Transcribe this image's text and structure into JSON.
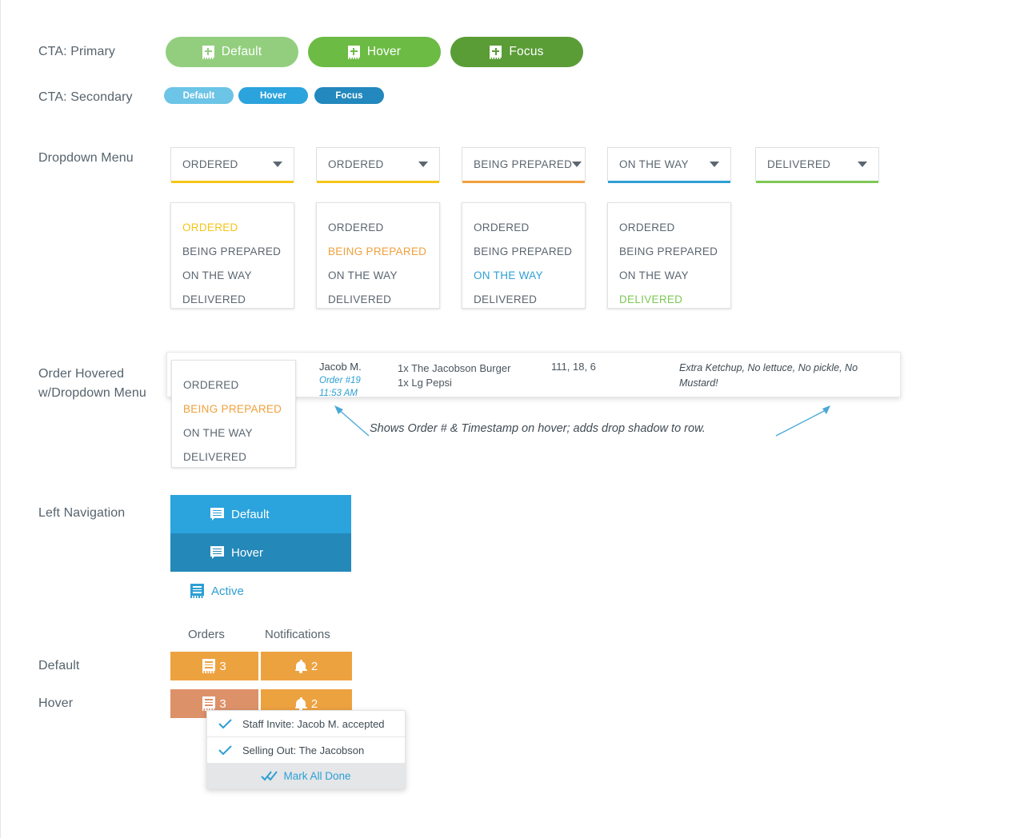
{
  "labels": {
    "cta_primary": "CTA: Primary",
    "cta_secondary": "CTA: Secondary",
    "dropdown_menu": "Dropdown Menu",
    "order_hovered": "Order Hovered w/Dropdown Menu",
    "left_navigation": "Left Navigation",
    "badge_default": "Default",
    "badge_hover": "Hover"
  },
  "cta_primary": {
    "buttons": [
      {
        "label": "Default",
        "color": "#92ce7e",
        "state": "default"
      },
      {
        "label": "Hover",
        "color": "#6cbb44",
        "state": "hover"
      },
      {
        "label": "Focus",
        "color": "#5a9c36",
        "state": "focus"
      }
    ],
    "icon": "receipt-plus-icon"
  },
  "cta_secondary": {
    "buttons": [
      {
        "label": "Default",
        "color": "#6cc4e6",
        "state": "default"
      },
      {
        "label": "Hover",
        "color": "#2ba3dc",
        "state": "hover"
      },
      {
        "label": "Focus",
        "color": "#2288bd",
        "state": "focus"
      }
    ]
  },
  "status_options": [
    "ORDERED",
    "BEING PREPARED",
    "ON THE WAY",
    "DELIVERED"
  ],
  "status_colors": {
    "ORDERED": "#f5c518",
    "BEING PREPARED": "#f0a03c",
    "ON THE WAY": "#2e9fd4",
    "DELIVERED": "#7dc855",
    "default": "#5b6670"
  },
  "dropdowns": [
    {
      "value": "ORDERED",
      "underline": "#f5c518",
      "highlight": "ORDERED"
    },
    {
      "value": "ORDERED",
      "underline": "#f5c518",
      "highlight": "BEING PREPARED"
    },
    {
      "value": "BEING PREPARED",
      "underline": "#f0a03c",
      "highlight": "ON THE WAY"
    },
    {
      "value": "ON THE WAY",
      "underline": "#2e9fd4",
      "highlight": "DELIVERED"
    },
    {
      "value": "DELIVERED",
      "underline": "#7dc855",
      "highlight": null
    }
  ],
  "order_row": {
    "customer": "Jacob M.",
    "order_number": "Order #19",
    "timestamp": "11:53 AM",
    "items": [
      "1x The Jacobson Burger",
      "1x Lg Pepsi"
    ],
    "numbers": "111, 18, 6",
    "notes": "Extra Ketchup, No lettuce, No pickle, No Mustard!",
    "dropdown_highlight": "BEING PREPARED",
    "annotation": "Shows Order # & Timestamp on hover; adds drop shadow to row."
  },
  "left_nav": {
    "items": [
      {
        "label": "Default",
        "bg": "#2ba3dc",
        "state": "default",
        "icon": "message-list-icon"
      },
      {
        "label": "Hover",
        "bg": "#2488b9",
        "state": "hover",
        "icon": "message-list-icon"
      },
      {
        "label": "Active",
        "bg": "transparent",
        "state": "active",
        "icon": "receipt-list-icon"
      }
    ]
  },
  "badges": {
    "headers": {
      "orders": "Orders",
      "notifications": "Notifications"
    },
    "default": {
      "orders": {
        "count": "3",
        "color": "#eda240",
        "icon": "receipt-icon"
      },
      "notifications": {
        "count": "2",
        "color": "#eda240",
        "icon": "bell-icon"
      }
    },
    "hover": {
      "orders": {
        "count": "3",
        "color": "#dd9169",
        "icon": "receipt-icon"
      },
      "notifications": {
        "count": "2",
        "color": "#eda240",
        "icon": "bell-icon"
      }
    }
  },
  "notification_menu": {
    "items": [
      {
        "text": "Staff Invite: Jacob M. accepted",
        "icon": "check-icon"
      },
      {
        "text": "Selling Out: The Jacobson",
        "icon": "check-icon"
      }
    ],
    "footer": {
      "text": "Mark All Done",
      "icon": "double-check-icon",
      "color": "#2e9fd4"
    }
  }
}
